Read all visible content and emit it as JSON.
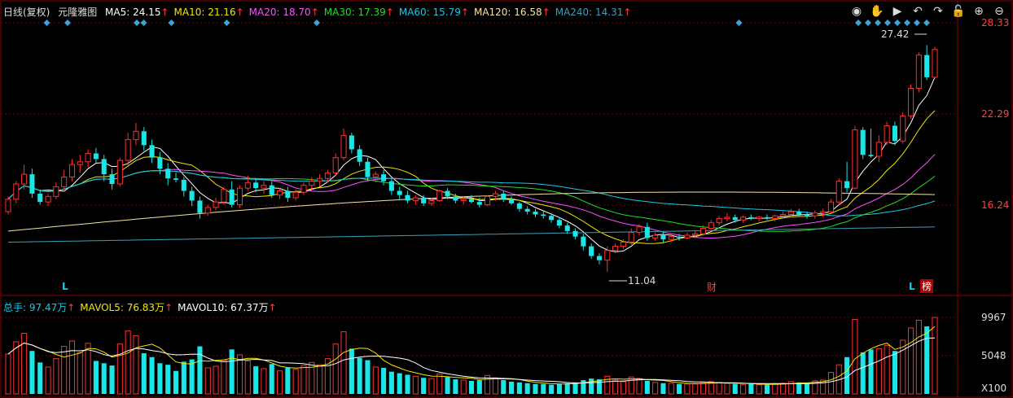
{
  "header": {
    "period": "日线(复权)",
    "stock_name": "元隆雅图",
    "ma": [
      {
        "label": "MA5: 24.15",
        "color": "#ffffff"
      },
      {
        "label": "MA10: 21.16",
        "color": "#f3e600"
      },
      {
        "label": "MA20: 18.70",
        "color": "#ff4fff"
      },
      {
        "label": "MA30: 17.39",
        "color": "#22dd22"
      },
      {
        "label": "MA60: 15.79",
        "color": "#19c8e6"
      },
      {
        "label": "MA120: 16.58",
        "color": "#f2e2a0"
      },
      {
        "label": "MA240: 14.31",
        "color": "#3aa0b8"
      }
    ],
    "arrow": "↑"
  },
  "toolbar": {
    "icons": [
      "eye-icon",
      "hand-icon",
      "play-icon",
      "undo-icon",
      "redo-icon",
      "lock-icon",
      "zoom-in-icon",
      "zoom-out-icon"
    ]
  },
  "price_axis": {
    "ticks": [
      "28.33",
      "22.29",
      "16.24"
    ]
  },
  "annotations": {
    "high_label": "27.42",
    "low_label": "11.04",
    "marker_l": "L",
    "marker_cai": "财",
    "marker_bang": "榜"
  },
  "volume": {
    "legend": [
      {
        "label": "总手: 97.47万",
        "color": "#19c8e6"
      },
      {
        "label": "MAVOL5: 76.83万",
        "color": "#f3e600"
      },
      {
        "label": "MAVOL10: 67.37万",
        "color": "#ffffff"
      }
    ],
    "axis": [
      "9967",
      "5048",
      "X100"
    ]
  },
  "colors": {
    "up": "#ff3030",
    "down": "#19e6e6",
    "grid": "#7a0000",
    "frame": "#8b0000"
  },
  "chart_data": {
    "type": "candlestick",
    "price_range": [
      10.0,
      29.5
    ],
    "volume_range": [
      0,
      10500
    ],
    "candles": [
      [
        15.4,
        16.5,
        15.2,
        16.3
      ],
      [
        16.3,
        17.6,
        16.0,
        17.4
      ],
      [
        17.4,
        18.8,
        17.0,
        18.1
      ],
      [
        18.1,
        18.5,
        16.4,
        16.7
      ],
      [
        16.7,
        17.0,
        15.9,
        16.1
      ],
      [
        16.1,
        16.7,
        15.8,
        16.5
      ],
      [
        16.5,
        17.5,
        16.3,
        17.2
      ],
      [
        17.2,
        18.4,
        17.0,
        17.9
      ],
      [
        17.9,
        19.2,
        17.6,
        18.8
      ],
      [
        18.8,
        19.5,
        18.2,
        19.0
      ],
      [
        19.0,
        19.9,
        18.6,
        19.6
      ],
      [
        19.6,
        20.0,
        18.9,
        19.2
      ],
      [
        19.2,
        19.5,
        17.6,
        18.1
      ],
      [
        18.1,
        18.5,
        17.0,
        17.4
      ],
      [
        17.4,
        19.3,
        17.2,
        19.1
      ],
      [
        19.1,
        21.1,
        18.7,
        20.6
      ],
      [
        20.6,
        21.8,
        20.2,
        21.2
      ],
      [
        21.2,
        21.5,
        19.8,
        20.2
      ],
      [
        20.2,
        20.6,
        18.9,
        19.3
      ],
      [
        19.3,
        19.7,
        18.1,
        18.5
      ],
      [
        18.5,
        18.9,
        17.3,
        17.8
      ],
      [
        17.8,
        18.2,
        17.5,
        17.7
      ],
      [
        17.7,
        17.9,
        16.5,
        16.9
      ],
      [
        16.9,
        17.2,
        15.8,
        16.2
      ],
      [
        16.2,
        16.5,
        14.9,
        15.3
      ],
      [
        15.3,
        15.9,
        15.1,
        15.7
      ],
      [
        15.7,
        16.4,
        15.5,
        16.1
      ],
      [
        16.1,
        17.2,
        15.9,
        17.0
      ],
      [
        17.0,
        17.6,
        15.7,
        15.9
      ],
      [
        15.9,
        17.3,
        15.7,
        17.1
      ],
      [
        17.1,
        18.0,
        16.9,
        17.5
      ],
      [
        17.5,
        17.8,
        16.8,
        17.1
      ],
      [
        17.1,
        17.6,
        16.7,
        17.3
      ],
      [
        17.3,
        17.6,
        16.4,
        16.6
      ],
      [
        16.6,
        17.1,
        16.3,
        16.9
      ],
      [
        16.9,
        17.2,
        16.1,
        16.4
      ],
      [
        16.4,
        17.0,
        16.2,
        16.8
      ],
      [
        16.8,
        17.5,
        16.6,
        17.3
      ],
      [
        17.3,
        17.9,
        17.0,
        17.6
      ],
      [
        17.6,
        18.1,
        17.2,
        17.8
      ],
      [
        17.8,
        18.4,
        17.5,
        18.2
      ],
      [
        18.2,
        19.6,
        18.0,
        19.3
      ],
      [
        19.3,
        21.4,
        19.1,
        20.9
      ],
      [
        20.9,
        21.1,
        19.6,
        19.9
      ],
      [
        19.9,
        20.2,
        18.7,
        19.0
      ],
      [
        19.0,
        19.3,
        17.6,
        17.9
      ],
      [
        17.9,
        18.3,
        17.5,
        18.1
      ],
      [
        18.1,
        18.4,
        17.3,
        17.6
      ],
      [
        17.6,
        17.8,
        16.6,
        16.9
      ],
      [
        16.9,
        17.2,
        16.3,
        16.6
      ],
      [
        16.6,
        16.9,
        16.0,
        16.2
      ],
      [
        16.2,
        16.6,
        15.9,
        16.4
      ],
      [
        16.4,
        16.6,
        15.8,
        16.0
      ],
      [
        16.0,
        16.4,
        15.8,
        16.2
      ],
      [
        16.2,
        17.0,
        16.1,
        16.9
      ],
      [
        16.9,
        17.1,
        16.3,
        16.5
      ],
      [
        16.5,
        16.7,
        16.0,
        16.2
      ],
      [
        16.2,
        16.5,
        15.9,
        16.3
      ],
      [
        16.3,
        16.6,
        16.0,
        16.1
      ],
      [
        16.1,
        16.4,
        15.7,
        15.9
      ],
      [
        15.9,
        16.6,
        15.8,
        16.5
      ],
      [
        16.5,
        16.9,
        16.2,
        16.7
      ],
      [
        16.7,
        16.9,
        16.1,
        16.3
      ],
      [
        16.3,
        16.5,
        15.9,
        16.0
      ],
      [
        16.0,
        16.1,
        15.4,
        15.6
      ],
      [
        15.6,
        15.8,
        15.2,
        15.4
      ],
      [
        15.4,
        15.6,
        15.0,
        15.2
      ],
      [
        15.2,
        15.4,
        14.9,
        15.1
      ],
      [
        15.1,
        15.3,
        14.6,
        14.8
      ],
      [
        14.8,
        15.0,
        14.2,
        14.4
      ],
      [
        14.4,
        14.6,
        13.8,
        14.0
      ],
      [
        14.0,
        14.2,
        13.4,
        13.6
      ],
      [
        13.6,
        13.8,
        12.6,
        12.9
      ],
      [
        12.9,
        13.1,
        12.0,
        12.2
      ],
      [
        12.2,
        12.4,
        11.6,
        11.9
      ],
      [
        11.9,
        12.9,
        11.04,
        12.6
      ],
      [
        12.6,
        13.1,
        12.4,
        12.9
      ],
      [
        12.9,
        13.4,
        12.7,
        13.2
      ],
      [
        13.2,
        14.2,
        13.0,
        13.9
      ],
      [
        13.9,
        14.5,
        13.7,
        14.3
      ],
      [
        14.3,
        14.6,
        13.3,
        13.5
      ],
      [
        13.5,
        13.9,
        13.3,
        13.7
      ],
      [
        13.7,
        13.9,
        13.2,
        13.4
      ],
      [
        13.4,
        13.8,
        13.2,
        13.6
      ],
      [
        13.6,
        13.8,
        13.3,
        13.5
      ],
      [
        13.5,
        13.9,
        13.4,
        13.7
      ],
      [
        13.7,
        14.0,
        13.5,
        13.8
      ],
      [
        13.8,
        14.4,
        13.7,
        14.2
      ],
      [
        14.2,
        14.8,
        14.1,
        14.6
      ],
      [
        14.6,
        15.1,
        14.4,
        14.9
      ],
      [
        14.9,
        15.3,
        14.7,
        15.0
      ],
      [
        15.0,
        15.2,
        14.6,
        14.8
      ],
      [
        14.8,
        15.1,
        14.6,
        15.0
      ],
      [
        15.0,
        15.2,
        14.8,
        14.9
      ],
      [
        14.9,
        15.1,
        14.7,
        15.0
      ],
      [
        15.0,
        15.2,
        14.8,
        14.9
      ],
      [
        14.9,
        15.2,
        14.7,
        15.1
      ],
      [
        15.1,
        15.4,
        14.9,
        15.2
      ],
      [
        15.2,
        15.6,
        15.0,
        15.4
      ],
      [
        15.4,
        15.6,
        15.1,
        15.2
      ],
      [
        15.2,
        15.4,
        14.9,
        15.1
      ],
      [
        15.1,
        15.5,
        14.9,
        15.3
      ],
      [
        15.3,
        15.6,
        15.0,
        15.4
      ],
      [
        15.4,
        16.3,
        15.3,
        16.1
      ],
      [
        16.1,
        17.8,
        15.9,
        17.6
      ],
      [
        17.6,
        19.0,
        16.8,
        17.1
      ],
      [
        17.1,
        21.6,
        17.0,
        21.3
      ],
      [
        21.3,
        21.5,
        19.2,
        19.5
      ],
      [
        19.5,
        21.4,
        19.3,
        19.4
      ],
      [
        19.4,
        20.9,
        19.0,
        20.4
      ],
      [
        20.4,
        21.9,
        20.2,
        21.6
      ],
      [
        21.6,
        21.9,
        20.2,
        20.5
      ],
      [
        20.5,
        22.6,
        20.3,
        22.3
      ],
      [
        22.3,
        24.6,
        22.1,
        24.3
      ],
      [
        24.3,
        26.9,
        24.0,
        26.7
      ],
      [
        26.7,
        27.42,
        24.9,
        25.1
      ],
      [
        25.1,
        27.3,
        25.0,
        27.1
      ]
    ],
    "volumes": [
      5200,
      6800,
      7900,
      5600,
      4100,
      3500,
      4600,
      6200,
      6900,
      5400,
      6600,
      4300,
      4000,
      3700,
      6500,
      8200,
      7600,
      5300,
      4800,
      4000,
      3800,
      3000,
      4200,
      4500,
      6200,
      3400,
      3600,
      4400,
      5800,
      5100,
      4300,
      3600,
      3300,
      3900,
      3000,
      3400,
      3200,
      3700,
      4100,
      3800,
      4600,
      6500,
      8100,
      5900,
      4700,
      4400,
      3500,
      3400,
      2900,
      2700,
      2500,
      2300,
      2100,
      2000,
      2600,
      2200,
      1900,
      1800,
      1700,
      1800,
      2400,
      2100,
      1800,
      1600,
      1500,
      1400,
      1300,
      1300,
      1200,
      1300,
      1400,
      1500,
      1800,
      2000,
      1900,
      2300,
      1800,
      1600,
      2200,
      2000,
      1700,
      1500,
      1400,
      1400,
      1300,
      1300,
      1300,
      1500,
      1600,
      1500,
      1400,
      1300,
      1200,
      1300,
      1200,
      1200,
      1300,
      1400,
      1600,
      1500,
      1400,
      1700,
      1800,
      2800,
      3800,
      4800,
      9700,
      5400,
      5800,
      5900,
      6300,
      5600,
      7000,
      8600,
      9600,
      8800,
      9967
    ]
  }
}
